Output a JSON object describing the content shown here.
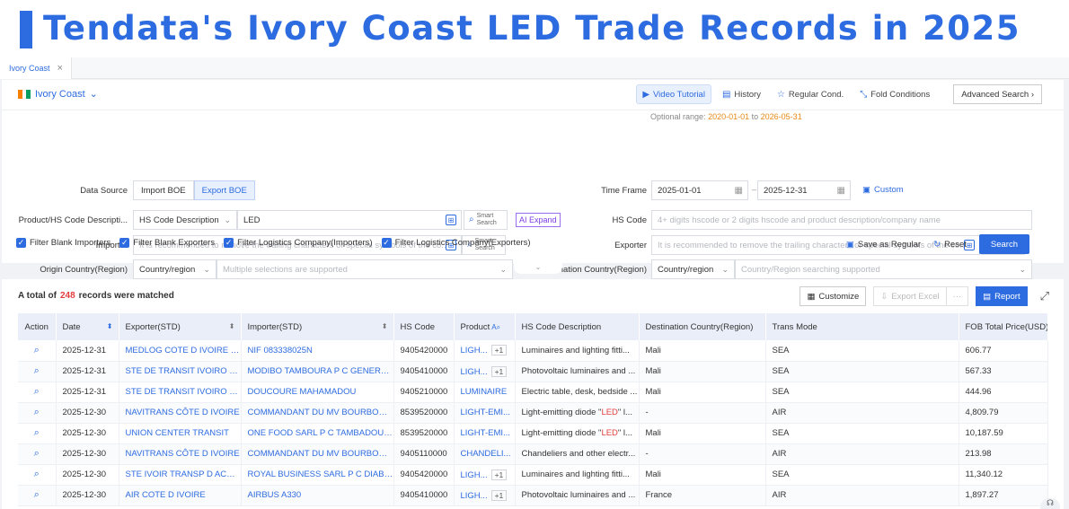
{
  "banner": {
    "title": "Tendata's Ivory Coast LED Trade Records in 2025"
  },
  "tabs": [
    {
      "label": "Ivory Coast",
      "close": "×"
    }
  ],
  "country": {
    "label": "Ivory Coast",
    "flag_colors": [
      "#f77f00",
      "#ffffff",
      "#009e60"
    ]
  },
  "toolbar": {
    "video": "Video Tutorial",
    "history": "History",
    "regular": "Regular Cond.",
    "fold": "Fold Conditions",
    "advanced": "Advanced Search ›"
  },
  "optional_range": {
    "prefix": "Optional range:",
    "start": "2020-01-01",
    "to": "to",
    "end": "2026-05-31"
  },
  "form": {
    "data_source_label": "Data Source",
    "import_boe": "Import BOE",
    "export_boe": "Export BOE",
    "time_frame_label": "Time Frame",
    "time_start": "2025-01-01",
    "time_sep": "–",
    "time_end": "2025-12-31",
    "custom": "Custom",
    "product_label": "Product/HS Code Descripti...",
    "product_type": "HS Code Description",
    "product_value": "LED",
    "smart_search": "Smart Search",
    "ai_expand": "AI Expand",
    "hs_code_label": "HS Code",
    "hs_code_placeholder": "4+ digits hscode or 2 digits hscode and product description/company name",
    "importer_label": "Importer",
    "importer_placeholder": "It is recommended to remove the trailing characters or special symbols of the co...",
    "exporter_label": "Exporter",
    "exporter_placeholder": "It is recommended to remove the trailing characters or special symbols of the co...",
    "origin_label": "Origin Country(Region)",
    "origin_type": "Country/region",
    "origin_placeholder": "Multiple selections are supported",
    "dest_label": "Destination Country(Region)",
    "dest_type": "Country/region",
    "dest_placeholder": "Country/Region searching supported"
  },
  "filters": [
    "Filter Blank Importers",
    "Filter Blank Exporters",
    "Filter Logistics Company(Importers)",
    "Filter Logistics Company(Exporters)"
  ],
  "actions": {
    "save": "Save as Regular",
    "reset": "Reset",
    "search": "Search"
  },
  "results": {
    "prefix": "A total of",
    "count": "248",
    "suffix": "records were matched",
    "customize": "Customize",
    "export": "Export Excel",
    "more": "···",
    "report": "Report"
  },
  "table": {
    "headers": [
      "Action",
      "Date",
      "Exporter(STD)",
      "Importer(STD)",
      "HS Code",
      "Product",
      "HS Code Description",
      "Destination Country(Region)",
      "Trans Mode",
      "FOB Total Price(USD)"
    ],
    "rows": [
      {
        "date": "2025-12-31",
        "exporter": "MEDLOG COTE D IVOIRE S A",
        "importer": "NIF 083338025N",
        "hs": "9405420000",
        "product": "LIGH...",
        "plus": "+1",
        "desc": "Luminaires and lighting fitti...",
        "dest": "Mali",
        "mode": "SEA",
        "fob": "606.77"
      },
      {
        "date": "2025-12-31",
        "exporter": "STE DE TRANSIT IVOIRO B...",
        "importer": "MODIBO TAMBOURA P C GENERAL ...",
        "hs": "9405410000",
        "product": "LIGH...",
        "plus": "+1",
        "desc": "Photovoltaic luminaires and ...",
        "dest": "Mali",
        "mode": "SEA",
        "fob": "567.33"
      },
      {
        "date": "2025-12-31",
        "exporter": "STE DE TRANSIT IVOIRO B...",
        "importer": "DOUCOURE MAHAMADOU",
        "hs": "9405210000",
        "product": "LUMINAIRE",
        "plus": "",
        "desc": "Electric table, desk, bedside ...",
        "dest": "Mali",
        "mode": "SEA",
        "fob": "444.96"
      },
      {
        "date": "2025-12-30",
        "exporter": "NAVITRANS CÔTE D IVOIRE",
        "importer": "COMMANDANT DU MV BOURBON E...",
        "hs": "8539520000",
        "product": "LIGHT-EMI...",
        "plus": "",
        "desc_pre": "Light-emitting diode \"",
        "desc_red": "LED",
        "desc_post": "\" l...",
        "dest": "-",
        "mode": "AIR",
        "fob": "4,809.79"
      },
      {
        "date": "2025-12-30",
        "exporter": "UNION CENTER TRANSIT",
        "importer": "ONE FOOD SARL P C TAMBADOU B...",
        "hs": "8539520000",
        "product": "LIGHT-EMI...",
        "plus": "",
        "desc_pre": "Light-emitting diode \"",
        "desc_red": "LED",
        "desc_post": "\" l...",
        "dest": "Mali",
        "mode": "SEA",
        "fob": "10,187.59"
      },
      {
        "date": "2025-12-30",
        "exporter": "NAVITRANS CÔTE D IVOIRE",
        "importer": "COMMANDANT DU MV BOURBON E...",
        "hs": "9405110000",
        "product": "CHANDELI...",
        "plus": "",
        "desc": "Chandeliers and other electr...",
        "dest": "-",
        "mode": "AIR",
        "fob": "213.98"
      },
      {
        "date": "2025-12-30",
        "exporter": "STE IVOIR TRANSP D ACC ...",
        "importer": "ROYAL BUSINESS SARL P C DIABY ...",
        "hs": "9405420000",
        "product": "LIGH...",
        "plus": "+1",
        "desc": "Luminaires and lighting fitti...",
        "dest": "Mali",
        "mode": "SEA",
        "fob": "11,340.12"
      },
      {
        "date": "2025-12-30",
        "exporter": "AIR COTE D IVOIRE",
        "importer": "AIRBUS A330",
        "hs": "9405410000",
        "product": "LIGH...",
        "plus": "+1",
        "desc": "Photovoltaic luminaires and ...",
        "dest": "France",
        "mode": "AIR",
        "fob": "1,897.27"
      }
    ]
  }
}
